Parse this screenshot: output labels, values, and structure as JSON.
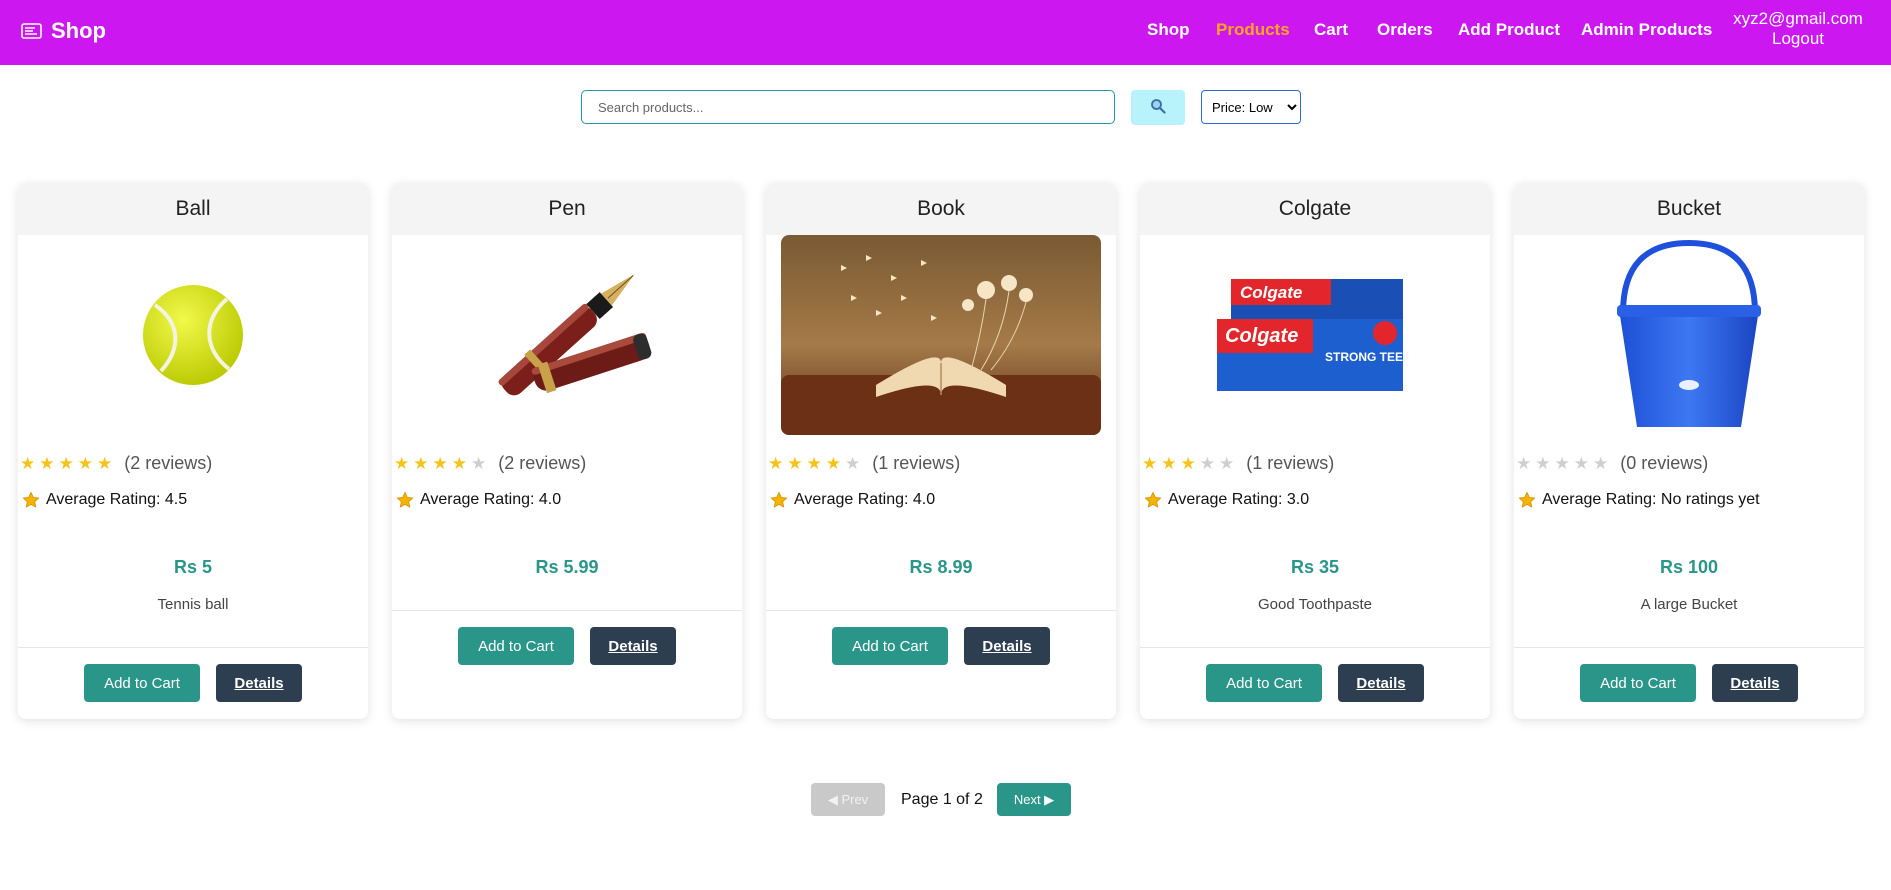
{
  "navbar": {
    "brand": "Shop",
    "links": [
      {
        "label": "Shop",
        "active": false
      },
      {
        "label": "Products",
        "active": true
      },
      {
        "label": "Cart",
        "active": false
      },
      {
        "label": "Orders",
        "active": false
      },
      {
        "label": "Add Product",
        "active": false
      },
      {
        "label": "Admin Products",
        "active": false
      }
    ],
    "user_email": "xyz2@gmail.com",
    "logout_label": "Logout",
    "colors": {
      "background": "#cc17f0",
      "active_link": "#ffa51e"
    }
  },
  "search": {
    "placeholder": "Search products...",
    "value": "",
    "button_icon": "magnifier-icon",
    "sort_selected": "Price: Low"
  },
  "products": [
    {
      "name": "Ball",
      "image_icon": "tennis-ball-image",
      "rating_stars": 5,
      "reviews": "(2 reviews)",
      "average_label": "Average Rating: 4.5",
      "price": "Rs 5",
      "description": "Tennis ball",
      "add_label": "Add to Cart",
      "details_label": "Details"
    },
    {
      "name": "Pen",
      "image_icon": "fountain-pen-image",
      "rating_stars": 4,
      "reviews": "(2 reviews)",
      "average_label": "Average Rating: 4.0",
      "price": "Rs 5.99",
      "description": "",
      "add_label": "Add to Cart",
      "details_label": "Details"
    },
    {
      "name": "Book",
      "image_icon": "open-book-image",
      "rating_stars": 4,
      "reviews": "(1 reviews)",
      "average_label": "Average Rating: 4.0",
      "price": "Rs 8.99",
      "description": "",
      "add_label": "Add to Cart",
      "details_label": "Details"
    },
    {
      "name": "Colgate",
      "image_icon": "toothpaste-image",
      "rating_stars": 3,
      "reviews": "(1 reviews)",
      "average_label": "Average Rating: 3.0",
      "price": "Rs 35",
      "description": "Good Toothpaste",
      "add_label": "Add to Cart",
      "details_label": "Details"
    },
    {
      "name": "Bucket",
      "image_icon": "blue-bucket-image",
      "rating_stars": 0,
      "reviews": "(0 reviews)",
      "average_label": "Average Rating: No ratings yet",
      "price": "Rs 100",
      "description": "A large Bucket",
      "add_label": "Add to Cart",
      "details_label": "Details"
    }
  ],
  "image_text": {
    "colgate_brand": "Colgate",
    "strong_teeth": "STRONG TEETH"
  },
  "pagination": {
    "prev_label": "◀ Prev",
    "info": "Page 1 of 2",
    "next_label": "Next ▶"
  },
  "theme": {
    "primary": "#2a968a",
    "dark": "#2c3e50",
    "star": "#f7c31a"
  }
}
